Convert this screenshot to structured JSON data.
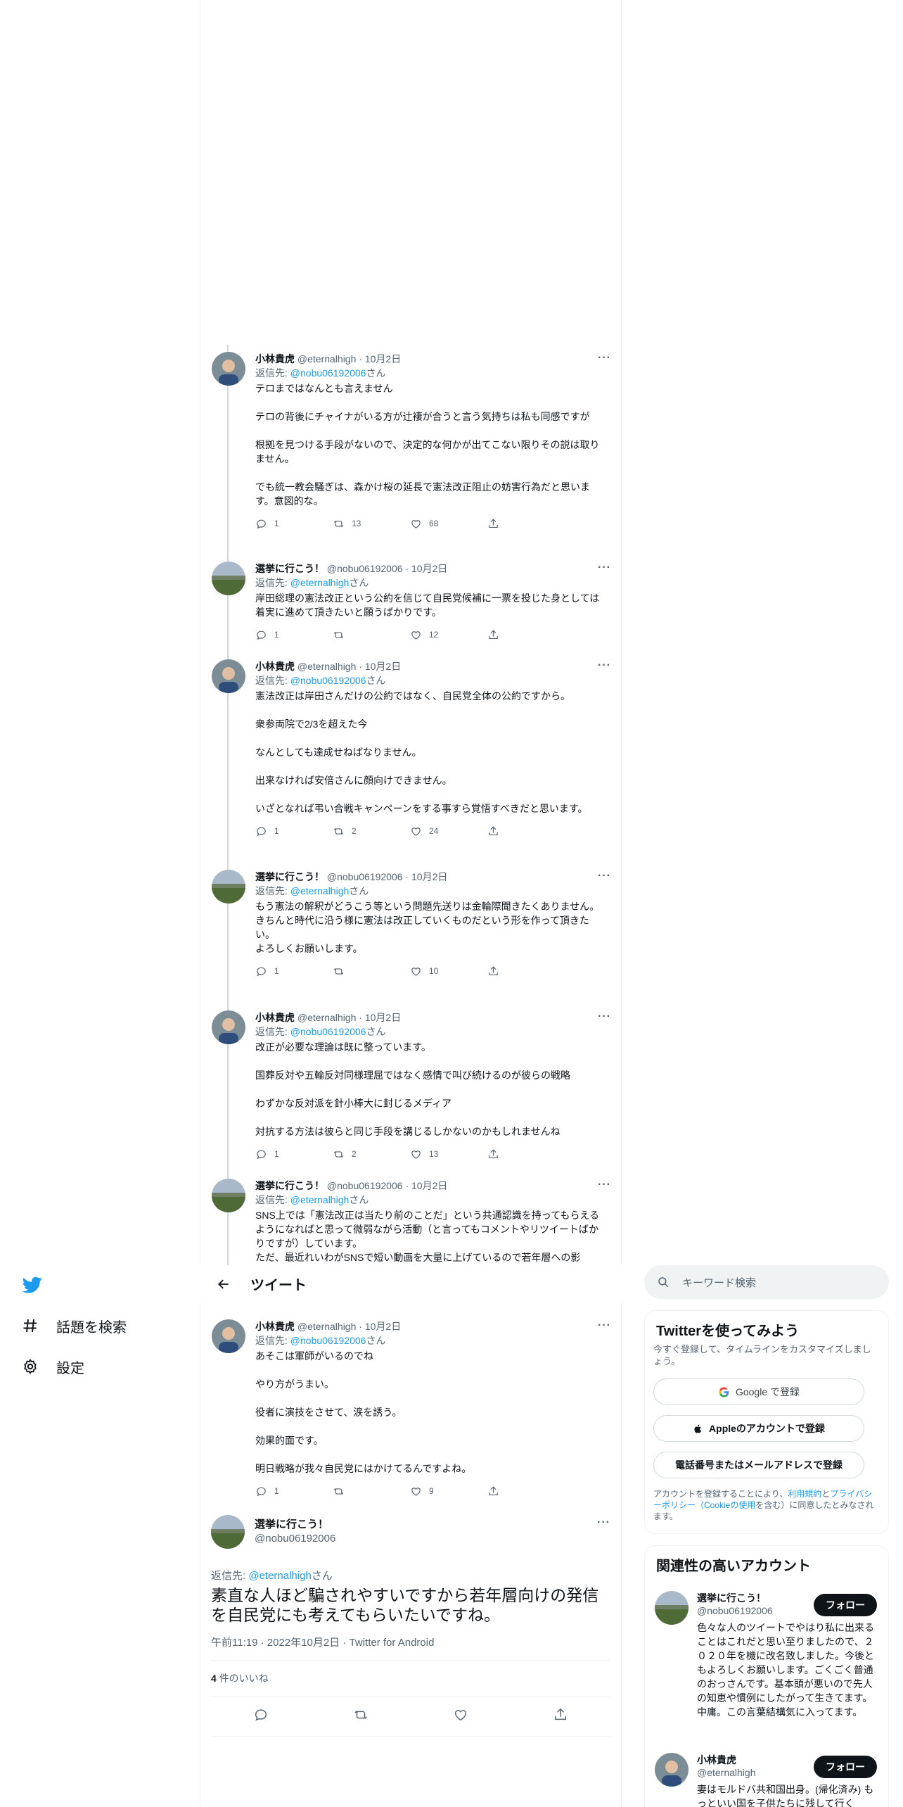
{
  "nav": {
    "items": [
      {
        "label": "話題を検索",
        "icon": "hashtag-icon"
      },
      {
        "label": "設定",
        "icon": "gear-icon"
      }
    ]
  },
  "header": {
    "title": "ツイート"
  },
  "thread": [
    {
      "name": "小林貴虎",
      "handle": "@eternalhigh",
      "date": "10月2日",
      "reply_to": "@nobu06192006",
      "reply_suffix": "さん",
      "text": "テロまではなんとも言えません\n\nテロの背後にチャイナがいる方が辻褄が合うと言う気持ちは私も同感ですが\n\n根拠を見つける手段がないので、決定的な何かが出てこない限りその説は取りません。\n\nでも統一教会騒ぎは、森かけ桜の延長で憲法改正阻止の妨害行為だと思います。意図的な。",
      "reply": "1",
      "retweet": "13",
      "like": "68"
    },
    {
      "name": "選挙に行こう！",
      "handle": "@nobu06192006",
      "date": "10月2日",
      "reply_to": "@eternalhigh",
      "reply_suffix": "さん",
      "text": "岸田総理の憲法改正という公約を信じて自民党候補に一票を投じた身としては着実に進めて頂きたいと願うばかりです。",
      "reply": "1",
      "retweet": "",
      "like": "12"
    },
    {
      "name": "小林貴虎",
      "handle": "@eternalhigh",
      "date": "10月2日",
      "reply_to": "@nobu06192006",
      "reply_suffix": "さん",
      "text": "憲法改正は岸田さんだけの公約ではなく、自民党全体の公約ですから。\n\n衆参両院で2/3を超えた今\n\nなんとしても達成せねばなりません。\n\n出来なければ安倍さんに顔向けできません。\n\nいざとなれば弔い合戦キャンペーンをする事すら覚悟すべきだと思います。",
      "reply": "1",
      "retweet": "2",
      "like": "24"
    },
    {
      "name": "選挙に行こう！",
      "handle": "@nobu06192006",
      "date": "10月2日",
      "reply_to": "@eternalhigh",
      "reply_suffix": "さん",
      "text": "もう憲法の解釈がどうこう等という問題先送りは金輪際聞きたくありません。\nきちんと時代に沿う様に憲法は改正していくものだという形を作って頂きたい。\nよろしくお願いします。",
      "reply": "1",
      "retweet": "",
      "like": "10"
    },
    {
      "name": "小林貴虎",
      "handle": "@eternalhigh",
      "date": "10月2日",
      "reply_to": "@nobu06192006",
      "reply_suffix": "さん",
      "text": "改正が必要な理論は既に整っています。\n\n国葬反対や五輪反対同様理屈ではなく感情で叫び続けるのが彼らの戦略\n\nわずかな反対派を針小棒大に封じるメディア\n\n対抗する方法は彼らと同じ手段を講じるしかないのかもしれませんね",
      "reply": "1",
      "retweet": "2",
      "like": "13"
    },
    {
      "name": "選挙に行こう！",
      "handle": "@nobu06192006",
      "date": "10月2日",
      "reply_to": "@eternalhigh",
      "reply_suffix": "さん",
      "text": "SNS上では「憲法改正は当たり前のことだ」という共通認識を持ってもらえるようになればと思って微弱ながら活動（と言ってもコメントやリツイートばかりですが）しています。\nただ、最近れいわがSNSで短い動画を大量に上げているので若年層への影",
      "reply": "",
      "retweet": "",
      "like": ""
    },
    {
      "name": "小林貴虎",
      "handle": "@eternalhigh",
      "date": "10月2日",
      "reply_to": "@nobu06192006",
      "reply_suffix": "さん",
      "text": "あそこは軍師がいるのでね\n\nやり方がうまい。\n\n役者に演技をさせて、涙を誘う。\n\n効果的面です。\n\n明日戦略が我々自民党にはかけてるんですよね。",
      "reply": "1",
      "retweet": "",
      "like": "9"
    }
  ],
  "focal": {
    "name": "選挙に行こう！",
    "handle": "@nobu06192006",
    "reply_prefix": "返信先: ",
    "reply_to": "@eternalhigh",
    "reply_suffix": "さん",
    "text": "素直な人ほど騙されやすいですから若年層向けの発信を自民党にも考えてもらいたいですね。",
    "time": "午前11:19",
    "date": "2022年10月2日",
    "source": "Twitter for Android",
    "likes_count": "4",
    "likes_label": " 件のいいね"
  },
  "labels": {
    "reply_prefix": "返信先: "
  },
  "right": {
    "search_placeholder": "キーワード検索",
    "signup": {
      "title": "Twitterを使ってみよう",
      "subtitle": "今すぐ登録して、タイムラインをカスタマイズしましょう。",
      "google": "Google で登録",
      "apple": "Appleのアカウントで登録",
      "phone": "電話番号またはメールアドレスで登録",
      "legal_pre": "アカウントを登録することにより、",
      "legal_terms": "利用規約",
      "legal_and": "と",
      "legal_privacy": "プライバシーポリシー（Cookieの使用",
      "legal_post": "を含む）に同意したとみなされます。"
    },
    "related": {
      "title": "関連性の高いアカウント",
      "accounts": [
        {
          "name": "選挙に行こう！",
          "handle": "@nobu06192006",
          "follow": "フォロー",
          "bio": "色々な人のツイートでやはり私に出来ることはこれだと思い至りましたので、２０２０年を機に改名致しました。今後ともよろしくお願いします。ごくごく普通のおっさんです。基本頭が悪いので先人の知恵や慣例にしたがって生きてます。中庸。この言葉結構気に入ってます。"
        },
        {
          "name": "小林貴虎",
          "handle": "@eternalhigh",
          "follow": "フォロー",
          "bio": "妻はモルドバ共和国出身。(帰化済み) もっといい国を子供たちに残して行く"
        }
      ]
    }
  },
  "colors": {
    "accent": "#1d9bf0",
    "text": "#0f1419",
    "muted": "#536471",
    "border": "#eff3f4"
  }
}
